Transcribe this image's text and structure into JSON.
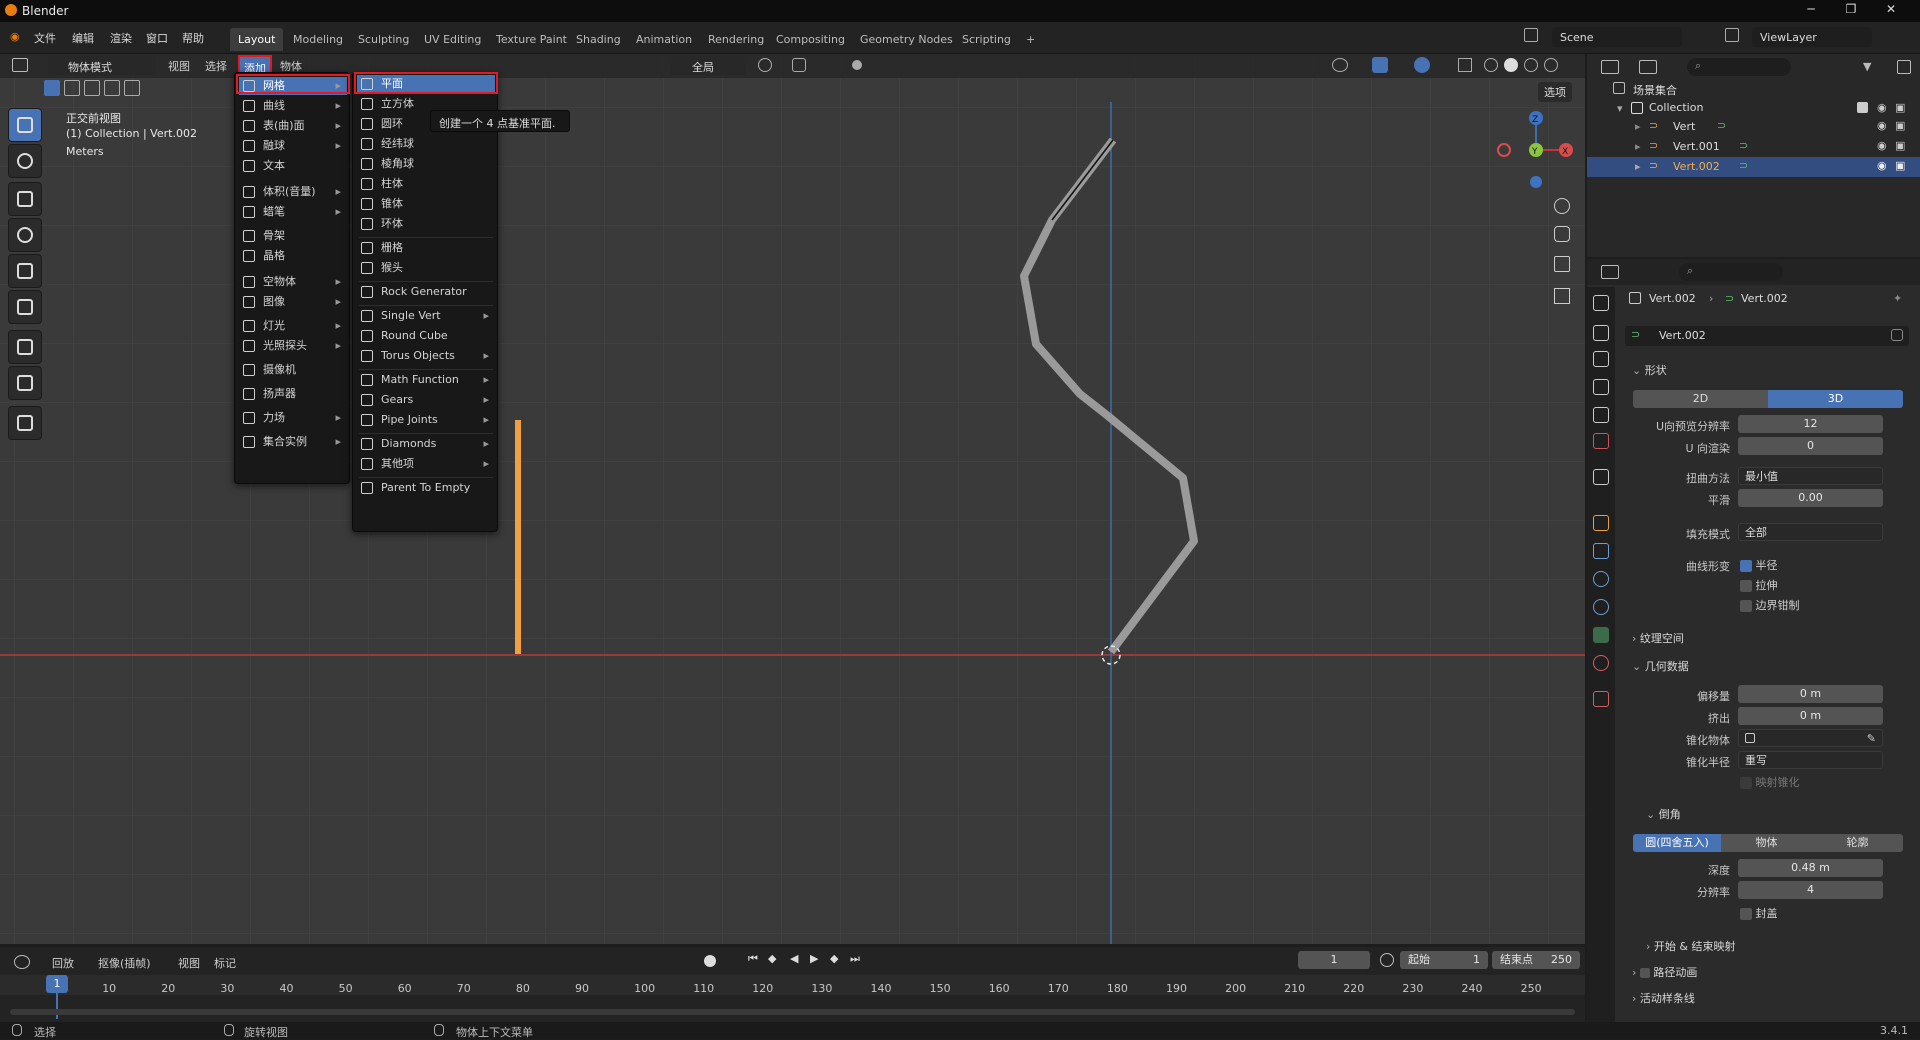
{
  "app": {
    "title": "Blender",
    "version": "3.4.1"
  },
  "menubar": {
    "items": [
      "文件",
      "编辑",
      "渲染",
      "窗口",
      "帮助"
    ],
    "workspaces": [
      "Layout",
      "Modeling",
      "Sculpting",
      "UV Editing",
      "Texture Paint",
      "Shading",
      "Animation",
      "Rendering",
      "Compositing",
      "Geometry Nodes",
      "Scripting",
      "+"
    ],
    "scene": "Scene",
    "view_layer": "ViewLayer"
  },
  "viewport_header": {
    "mode": "物体模式",
    "items": [
      "视图",
      "选择",
      "添加",
      "物体"
    ],
    "transform": "全局",
    "options": "选项"
  },
  "overlay_text": {
    "view_name": "正交前视图",
    "collection": "(1) Collection | Vert.002",
    "units": "Meters"
  },
  "add_menu": {
    "items": [
      {
        "label": "网格",
        "icon": "mesh-icon",
        "sub": true
      },
      {
        "label": "曲线",
        "icon": "curve-icon",
        "sub": true
      },
      {
        "label": "表(曲)面",
        "icon": "surface-icon",
        "sub": true
      },
      {
        "label": "融球",
        "icon": "metaball-icon",
        "sub": true
      },
      {
        "label": "文本",
        "icon": "text-icon",
        "sub": false
      },
      {
        "label": "体积(音量)",
        "icon": "volume-icon",
        "sub": true
      },
      {
        "label": "蜡笔",
        "icon": "grease-pencil-icon",
        "sub": true
      },
      {
        "label": "骨架",
        "icon": "armature-icon",
        "sub": false
      },
      {
        "label": "晶格",
        "icon": "lattice-icon",
        "sub": false
      },
      {
        "label": "空物体",
        "icon": "empty-icon",
        "sub": true
      },
      {
        "label": "图像",
        "icon": "image-icon",
        "sub": true
      },
      {
        "label": "灯光",
        "icon": "light-icon",
        "sub": true
      },
      {
        "label": "光照探头",
        "icon": "light-probe-icon",
        "sub": true
      },
      {
        "label": "摄像机",
        "icon": "camera-icon",
        "sub": false
      },
      {
        "label": "扬声器",
        "icon": "speaker-icon",
        "sub": false
      },
      {
        "label": "力场",
        "icon": "force-field-icon",
        "sub": true
      },
      {
        "label": "集合实例",
        "icon": "collection-icon",
        "sub": true
      }
    ]
  },
  "mesh_menu": {
    "items": [
      {
        "label": "平面",
        "sub": false
      },
      {
        "label": "立方体",
        "sub": false
      },
      {
        "label": "圆环",
        "sub": false
      },
      {
        "label": "经纬球",
        "sub": false
      },
      {
        "label": "棱角球",
        "sub": false
      },
      {
        "label": "柱体",
        "sub": false
      },
      {
        "label": "锥体",
        "sub": false
      },
      {
        "label": "环体",
        "sub": false
      },
      {
        "label": "栅格",
        "sub": false
      },
      {
        "label": "猴头",
        "sub": false
      },
      {
        "label": "Rock Generator",
        "sub": false
      },
      {
        "label": "Single Vert",
        "sub": true
      },
      {
        "label": "Round Cube",
        "sub": false
      },
      {
        "label": "Torus Objects",
        "sub": true
      },
      {
        "label": "Math Function",
        "sub": true
      },
      {
        "label": "Gears",
        "sub": true
      },
      {
        "label": "Pipe Joints",
        "sub": true
      },
      {
        "label": "Diamonds",
        "sub": true
      },
      {
        "label": "其他项",
        "sub": true
      },
      {
        "label": "Parent To Empty",
        "sub": false
      }
    ],
    "tooltip": "创建一个 4 点基准平面."
  },
  "outliner": {
    "root": "场景集合",
    "collection": "Collection",
    "objects": [
      "Vert",
      "Vert.001",
      "Vert.002"
    ]
  },
  "properties": {
    "breadcrumb_obj": "Vert.002",
    "breadcrumb_data": "Vert.002",
    "datablock": "Vert.002",
    "shape": {
      "title": "形状",
      "mode_2d": "2D",
      "mode_3d": "3D",
      "u_preview_label": "U向预览分辨率",
      "u_preview": "12",
      "u_render_label": "U 向渲染",
      "u_render": "0",
      "twist_label": "扭曲方法",
      "twist": "最小值",
      "smooth_label": "平滑",
      "smooth": "0.00",
      "fill_label": "填充模式",
      "fill": "全部",
      "deform_label": "曲线形变",
      "radius": "半径",
      "stretch": "拉伸",
      "clamp": "边界钳制"
    },
    "texture_space": "纹理空间",
    "geometry": {
      "title": "几何数据",
      "offset_label": "偏移量",
      "offset": "0 m",
      "extrude_label": "挤出",
      "extrude": "0 m",
      "taper_label": "锥化物体",
      "taper_radius_label": "锥化半径",
      "taper_radius": "重写",
      "map_taper": "映射锥化"
    },
    "bevel": {
      "title": "倒角",
      "tabs": [
        "圆(四舍五入)",
        "物体",
        "轮廓"
      ],
      "depth_label": "深度",
      "depth": "0.48 m",
      "res_label": "分辨率",
      "res": "4",
      "fill_caps": "封盖"
    },
    "start_end": "开始 & 结束映射",
    "path_anim": "路径动画",
    "active_spline": "活动样条线"
  },
  "timeline": {
    "items": [
      "回放",
      "抠像(插帧)",
      "视图",
      "标记"
    ],
    "current_frame": "1",
    "start_label": "起始",
    "start": "1",
    "end_label": "结束点",
    "end": "250",
    "ticks": [
      "1",
      "10",
      "20",
      "30",
      "40",
      "50",
      "60",
      "70",
      "80",
      "90",
      "100",
      "110",
      "120",
      "130",
      "140",
      "150",
      "160",
      "170",
      "180",
      "190",
      "200",
      "210",
      "220",
      "230",
      "240",
      "250"
    ]
  },
  "statusbar": {
    "select": "选择",
    "rotate": "旋转视图",
    "context": "物体上下文菜单"
  }
}
